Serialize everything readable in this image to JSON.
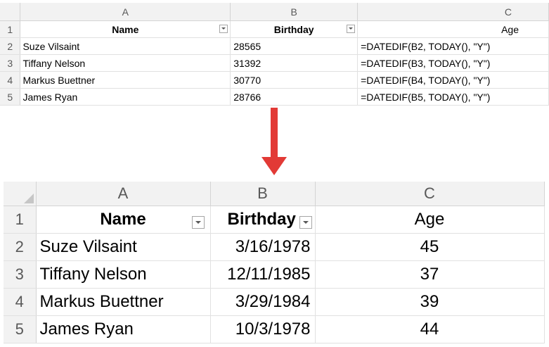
{
  "columns": [
    "A",
    "B",
    "C"
  ],
  "row_numbers": [
    "1",
    "2",
    "3",
    "4",
    "5"
  ],
  "headers": {
    "name": "Name",
    "birthday": "Birthday",
    "age": "Age"
  },
  "before": {
    "rows": [
      {
        "name": "Suze Vilsaint",
        "birthday": "28565",
        "age": "=DATEDIF(B2, TODAY(), \"Y\")"
      },
      {
        "name": "Tiffany Nelson",
        "birthday": "31392",
        "age": "=DATEDIF(B3, TODAY(), \"Y\")"
      },
      {
        "name": "Markus Buettner",
        "birthday": "30770",
        "age": "=DATEDIF(B4, TODAY(), \"Y\")"
      },
      {
        "name": "James Ryan",
        "birthday": "28766",
        "age": "=DATEDIF(B5, TODAY(), \"Y\")"
      }
    ]
  },
  "after": {
    "rows": [
      {
        "name": "Suze Vilsaint",
        "birthday": "3/16/1978",
        "age": "45"
      },
      {
        "name": "Tiffany Nelson",
        "birthday": "12/11/1985",
        "age": "37"
      },
      {
        "name": "Markus Buettner",
        "birthday": "3/29/1984",
        "age": "39"
      },
      {
        "name": "James Ryan",
        "birthday": "10/3/1978",
        "age": "44"
      }
    ]
  },
  "icons": {
    "filter": "filter-dropdown-icon",
    "arrow": "arrow-down-icon"
  },
  "colors": {
    "arrow": "#e23a36",
    "header_bg": "#f2f2f2",
    "gridline": "#e1e1e1"
  }
}
